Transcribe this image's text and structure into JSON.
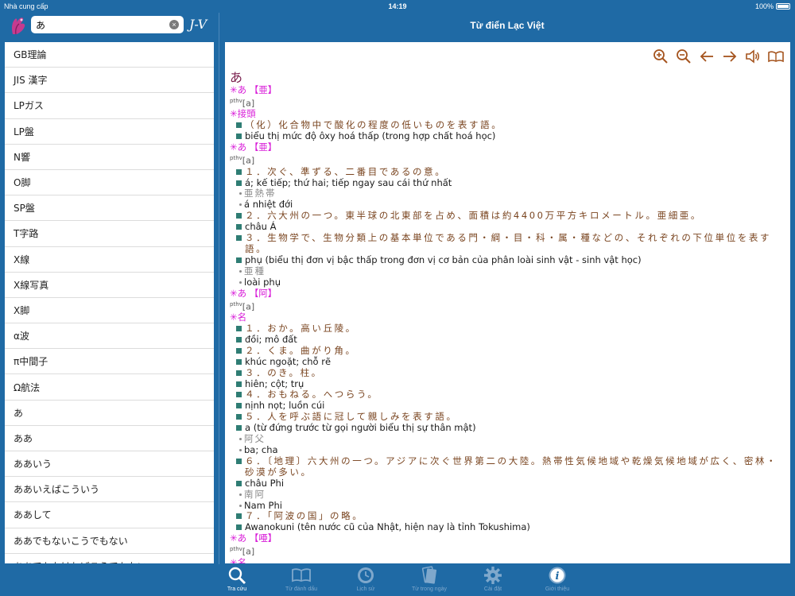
{
  "status": {
    "carrier": "Nhà cung cấp",
    "time": "14:19",
    "battery": "100%"
  },
  "search": {
    "value": "あ",
    "placeholder": "",
    "clear": "×"
  },
  "lang_toggle": "J-V",
  "title": "Từ điển Lạc Việt",
  "word_list": [
    "GB理論",
    "JIS 漢字",
    "LPガス",
    "LP盤",
    "N響",
    "O脚",
    "SP盤",
    "T字路",
    "X線",
    "X線写真",
    "X脚",
    "α波",
    "π中間子",
    "Ω航法",
    "あ",
    "ああ",
    "ああいう",
    "ああいえばこういう",
    "ああして",
    "ああでもないこうでもない",
    "ああでもなければこうでもない"
  ],
  "toolbar": [
    "zoom-in-icon",
    "zoom-out-icon",
    "arrow-left-icon",
    "arrow-right-icon",
    "speaker-icon",
    "book-icon"
  ],
  "entry": {
    "headword": "あ",
    "pron_label": "pthv",
    "lines": [
      {
        "t": "hdr",
        "text": "✳あ 【亜】"
      },
      {
        "t": "pron",
        "text": "[a]"
      },
      {
        "t": "hdr",
        "text": "✳接頭"
      },
      {
        "t": "jp",
        "text": "（化）化合物中で酸化の程度の低いものを表す語。"
      },
      {
        "t": "vn",
        "text": "biểu thị mức độ ôxy hoá thấp (trong hợp chất hoá học)"
      },
      {
        "t": "hdr",
        "text": "✳あ 【亜】"
      },
      {
        "t": "pron",
        "text": "[a]"
      },
      {
        "t": "jp",
        "text": "１．次ぐ、準ずる、二番目であるの意。"
      },
      {
        "t": "vn",
        "text": "á; kế tiếp; thứ hai; tiếp ngay sau cái thứ nhất"
      },
      {
        "t": "exjp",
        "text": "亜熱帯"
      },
      {
        "t": "exvn",
        "text": "á nhiệt đới"
      },
      {
        "t": "jp",
        "text": "２．六大州の一つ。東半球の北東部を占め、面積は約4400万平方キロメートル。亜細亜。"
      },
      {
        "t": "vn",
        "text": "châu Á"
      },
      {
        "t": "jpw",
        "text": "３．生物学で、生物分類上の基本単位である門・綱・目・科・属・種などの、それぞれの下位単位を表す語。"
      },
      {
        "t": "vn",
        "text": "phụ (biểu thị đơn vị bậc thấp trong đơn vị cơ bản của phân loài sinh vật - sinh vật học)"
      },
      {
        "t": "exjp",
        "text": "亜種"
      },
      {
        "t": "exvn",
        "text": "loài phụ"
      },
      {
        "t": "hdr",
        "text": "✳あ 【阿】"
      },
      {
        "t": "pron",
        "text": "[a]"
      },
      {
        "t": "hdr",
        "text": "✳名"
      },
      {
        "t": "jp",
        "text": "１．おか。高い丘陵。"
      },
      {
        "t": "vn",
        "text": "đồi; mô đất"
      },
      {
        "t": "jp",
        "text": "２．くま。曲がり角。"
      },
      {
        "t": "vn",
        "text": "khúc ngoặt; chỗ rẽ"
      },
      {
        "t": "jp",
        "text": "３．のき。柱。"
      },
      {
        "t": "vn",
        "text": "hiên; cột; trụ"
      },
      {
        "t": "jp",
        "text": "４．おもねる。へつらう。"
      },
      {
        "t": "vn",
        "text": "nịnh nọt; luồn cúi"
      },
      {
        "t": "jp",
        "text": "５．人を呼ぶ語に冠して親しみを表す語。"
      },
      {
        "t": "vn",
        "text": "a (từ đứng trước từ gọi người biểu thị sự thân mật)"
      },
      {
        "t": "exjp",
        "text": "阿父"
      },
      {
        "t": "exvn",
        "text": "ba; cha"
      },
      {
        "t": "jpw",
        "text": "６．〔地理〕六大州の一つ。アジアに次ぐ世界第二の大陸。熱帯性気候地域や乾燥気候地域が広く、密林・砂漠が多い。"
      },
      {
        "t": "vn",
        "text": "châu Phi"
      },
      {
        "t": "exjp",
        "text": "南阿"
      },
      {
        "t": "exvn",
        "text": "Nam Phi"
      },
      {
        "t": "jp",
        "text": "７．「阿波の国」の略。"
      },
      {
        "t": "vn",
        "text": "Awanokuni (tên nước cũ của Nhật, hiện nay là tỉnh Tokushima)"
      },
      {
        "t": "hdr",
        "text": "✳あ 【唖】"
      },
      {
        "t": "pron",
        "text": "[a]"
      },
      {
        "t": "hdr",
        "text": "✳名"
      }
    ]
  },
  "tabs": [
    {
      "label": "Tra cứu",
      "icon": "search-icon",
      "active": true
    },
    {
      "label": "Từ đánh dấu",
      "icon": "bookmark-book-icon",
      "active": false
    },
    {
      "label": "Lịch sử",
      "icon": "history-icon",
      "active": false
    },
    {
      "label": "Từ trong ngày",
      "icon": "daily-word-icon",
      "active": false
    },
    {
      "label": "Cài đặt",
      "icon": "gear-icon",
      "active": false
    },
    {
      "label": "Giới thiệu",
      "icon": "info-icon",
      "active": false
    }
  ],
  "colors": {
    "bar": "#1f6aa5",
    "header_magenta": "#d81cd8",
    "jp_brown": "#7a4520",
    "bullet": "#2f7d74",
    "icon_brown": "#a5541e"
  }
}
